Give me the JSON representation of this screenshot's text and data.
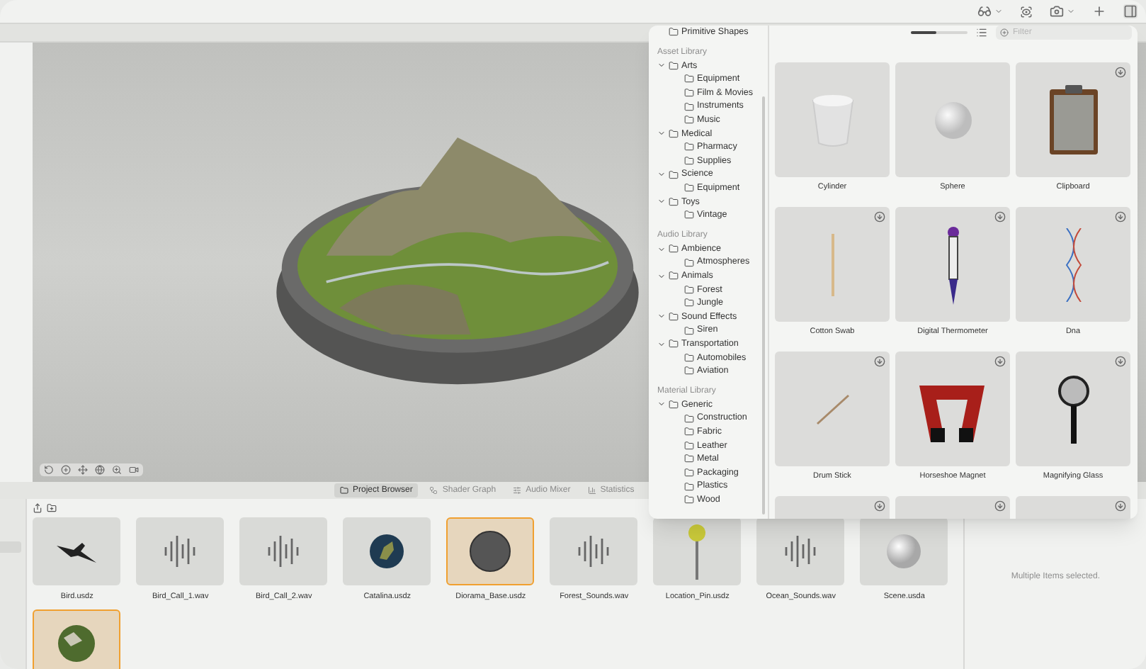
{
  "bottom_tabs": [
    {
      "label": "Project Browser",
      "selected": true
    },
    {
      "label": "Shader Graph",
      "selected": false
    },
    {
      "label": "Audio Mixer",
      "selected": false
    },
    {
      "label": "Statistics",
      "selected": false
    }
  ],
  "project_items": [
    {
      "label": "Bird.usdz",
      "kind": "bird",
      "selected": false
    },
    {
      "label": "Bird_Call_1.wav",
      "kind": "audio",
      "selected": false
    },
    {
      "label": "Bird_Call_2.wav",
      "kind": "audio",
      "selected": false
    },
    {
      "label": "Catalina.usdz",
      "kind": "globe",
      "selected": false
    },
    {
      "label": "Diorama_Base.usdz",
      "kind": "disk",
      "selected": true
    },
    {
      "label": "Forest_Sounds.wav",
      "kind": "audio",
      "selected": false
    },
    {
      "label": "Location_Pin.usdz",
      "kind": "pin",
      "selected": false
    },
    {
      "label": "Ocean_Sounds.wav",
      "kind": "audio",
      "selected": false
    },
    {
      "label": "Scene.usda",
      "kind": "sphere",
      "selected": false
    },
    {
      "kind": "terrain",
      "selected": true
    }
  ],
  "inspector": {
    "message": "Multiple Items selected."
  },
  "popover": {
    "tree": [
      {
        "label": "Primitive Shapes",
        "kind": "folder"
      },
      {
        "label": "Asset Library",
        "kind": "section"
      },
      {
        "label": "Arts",
        "kind": "folder",
        "expanded": true,
        "children": [
          {
            "label": "Equipment"
          },
          {
            "label": "Film & Movies"
          },
          {
            "label": "Instruments"
          },
          {
            "label": "Music"
          }
        ]
      },
      {
        "label": "Medical",
        "kind": "folder",
        "expanded": true,
        "children": [
          {
            "label": "Pharmacy"
          },
          {
            "label": "Supplies"
          }
        ]
      },
      {
        "label": "Science",
        "kind": "folder",
        "expanded": true,
        "children": [
          {
            "label": "Equipment"
          }
        ]
      },
      {
        "label": "Toys",
        "kind": "folder",
        "expanded": true,
        "children": [
          {
            "label": "Vintage"
          }
        ]
      },
      {
        "label": "Audio Library",
        "kind": "section"
      },
      {
        "label": "Ambience",
        "kind": "folder",
        "expanded": true,
        "children": [
          {
            "label": "Atmospheres"
          }
        ]
      },
      {
        "label": "Animals",
        "kind": "folder",
        "expanded": true,
        "children": [
          {
            "label": "Forest"
          },
          {
            "label": "Jungle"
          }
        ]
      },
      {
        "label": "Sound Effects",
        "kind": "folder",
        "expanded": true,
        "children": [
          {
            "label": "Siren"
          }
        ]
      },
      {
        "label": "Transportation",
        "kind": "folder",
        "expanded": true,
        "children": [
          {
            "label": "Automobiles"
          },
          {
            "label": "Aviation"
          }
        ]
      },
      {
        "label": "Material Library",
        "kind": "section"
      },
      {
        "label": "Generic",
        "kind": "folder",
        "expanded": true,
        "children": [
          {
            "label": "Construction"
          },
          {
            "label": "Fabric"
          },
          {
            "label": "Leather"
          },
          {
            "label": "Metal"
          },
          {
            "label": "Packaging"
          },
          {
            "label": "Plastics"
          },
          {
            "label": "Wood"
          }
        ]
      }
    ],
    "size_slider": {
      "level": 0.45
    },
    "filter": {
      "placeholder": "Filter"
    },
    "assets": [
      {
        "label": "Cylinder",
        "kind": "cylinder",
        "download": false
      },
      {
        "label": "Sphere",
        "kind": "sphere",
        "download": false
      },
      {
        "label": "Clipboard",
        "kind": "clipboard",
        "download": true
      },
      {
        "label": "Cotton Swab",
        "kind": "swab",
        "download": true
      },
      {
        "label": "Digital Thermometer",
        "kind": "thermometer",
        "download": true
      },
      {
        "label": "Dna",
        "kind": "dna",
        "download": true
      },
      {
        "label": "Drum Stick",
        "kind": "stick",
        "download": true
      },
      {
        "label": "Horseshoe Magnet",
        "kind": "magnet",
        "download": true
      },
      {
        "label": "Magnifying Glass",
        "kind": "magnifier",
        "download": true
      },
      {
        "kind": "blank",
        "download": true
      },
      {
        "kind": "blank",
        "download": true
      },
      {
        "kind": "blank",
        "download": true
      }
    ]
  }
}
